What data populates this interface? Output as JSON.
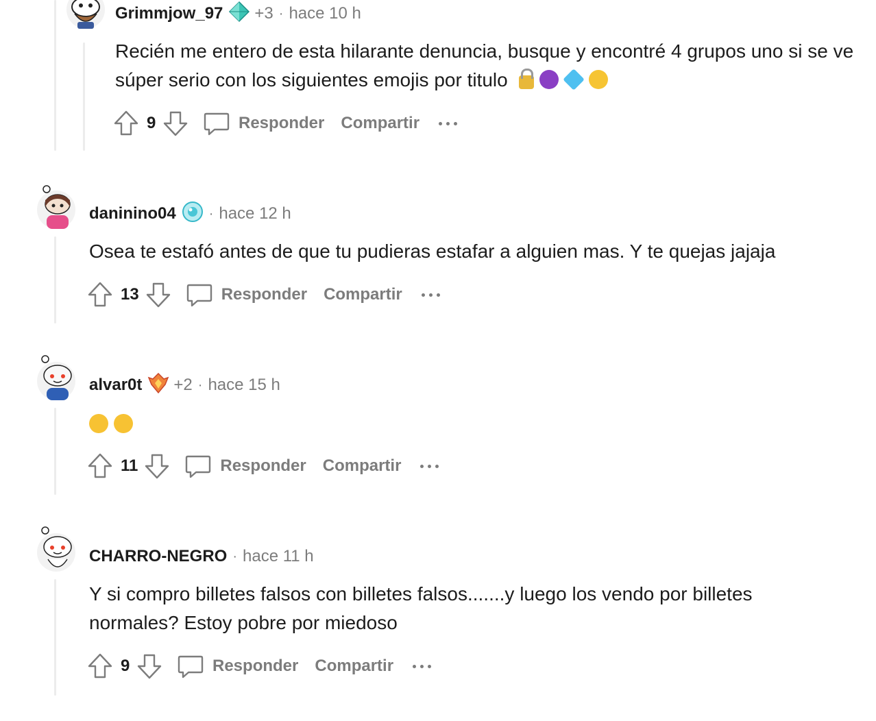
{
  "comments": [
    {
      "username": "Grimmjow_97",
      "flair_extra": "+3",
      "time": "hace 10 h",
      "body": "Recién me entero de esta hilarante denuncia, busque y encontré 4 grupos uno si se ve súper serio con los siguientes emojis por titulo",
      "emojis": [
        "lock-emoji",
        "devil-emoji",
        "gem-emoji",
        "money-mouth-emoji"
      ],
      "votes": "9",
      "reply_label": "Responder",
      "share_label": "Compartir"
    },
    {
      "username": "daninino04",
      "time": "hace 12 h",
      "body": "Osea te estafó antes de que tu pudieras estafar a alguien mas. Y te quejas jajaja",
      "votes": "13",
      "reply_label": "Responder",
      "share_label": "Compartir"
    },
    {
      "username": "alvar0t",
      "flair_extra": "+2",
      "time": "hace 15 h",
      "emojis": [
        "rofl-emoji",
        "rofl-emoji"
      ],
      "votes": "11",
      "reply_label": "Responder",
      "share_label": "Compartir"
    },
    {
      "username": "CHARRO-NEGRO",
      "time": "hace 11 h",
      "body": "Y si compro billetes falsos con billetes falsos.......y luego los vendo por billetes normales? Estoy pobre por miedoso",
      "votes": "9",
      "reply_label": "Responder",
      "share_label": "Compartir"
    }
  ],
  "separator": "·",
  "colors": {
    "text": "#1c1c1c",
    "muted": "#7c7c7c",
    "thread_line": "#ececec",
    "background": "#ffffff"
  }
}
